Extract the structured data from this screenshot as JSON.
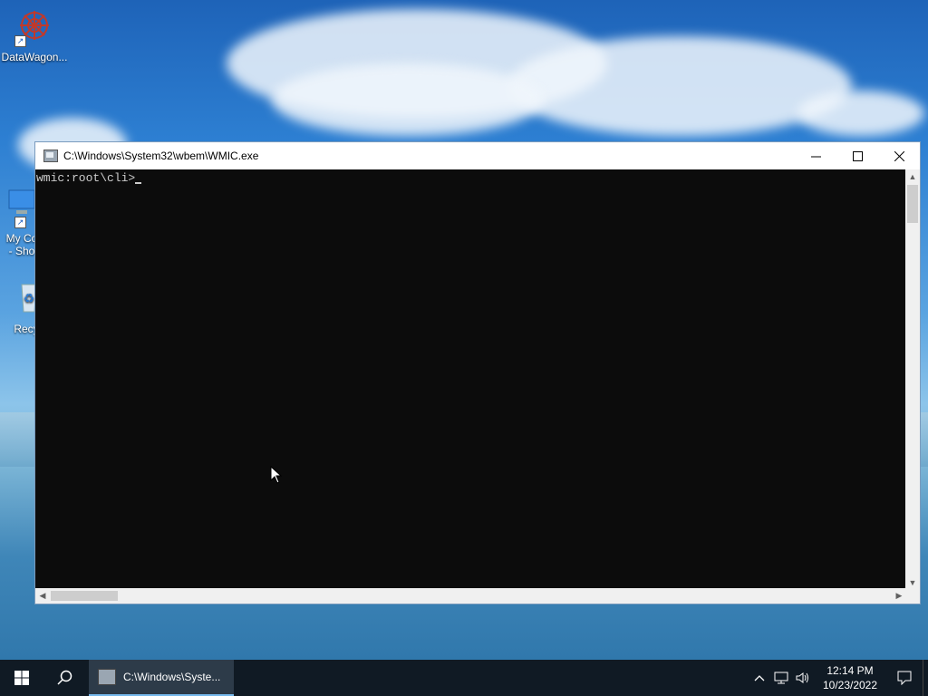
{
  "desktop": {
    "icons": [
      {
        "label": "DataWagon..."
      },
      {
        "label": "My Co",
        "label2": "- Sho"
      },
      {
        "label": "Recyc"
      }
    ]
  },
  "window": {
    "title": "C:\\Windows\\System32\\wbem\\WMIC.exe",
    "prompt": "wmic:root\\cli>",
    "minimize_icon": "minimize-icon",
    "maximize_icon": "maximize-icon",
    "close_icon": "close-icon"
  },
  "taskbar": {
    "start_icon": "windows-start-icon",
    "search_icon": "search-icon",
    "task_label": "C:\\Windows\\Syste...",
    "tray": {
      "chevron_icon": "chevron-up-icon",
      "network_icon": "network-icon",
      "volume_icon": "volume-icon"
    },
    "clock": {
      "time": "12:14 PM",
      "date": "10/23/2022"
    },
    "notification_icon": "notification-icon"
  },
  "colors": {
    "console_bg": "#0c0c0c",
    "console_fg": "#cccccc",
    "taskbar_bg": "#101a24",
    "task_active_bg": "#2d3b49",
    "accent": "#76b9ed"
  }
}
